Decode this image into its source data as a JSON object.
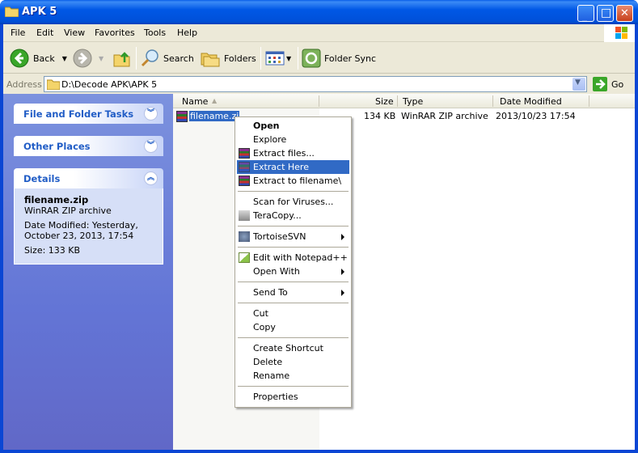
{
  "window": {
    "title": "APK 5",
    "buttons": {
      "minimize": "_",
      "maximize": "□",
      "close": "✕"
    }
  },
  "menubar": {
    "items": [
      "File",
      "Edit",
      "View",
      "Favorites",
      "Tools",
      "Help"
    ]
  },
  "toolbar": {
    "back_label": "Back",
    "search_label": "Search",
    "folders_label": "Folders",
    "folder_sync_label": "Folder Sync"
  },
  "address": {
    "label": "Address",
    "value": "D:\\Decode APK\\APK 5",
    "go_label": "Go"
  },
  "leftpane": {
    "panels": [
      {
        "title": "File and Folder Tasks",
        "chevron": "expand"
      },
      {
        "title": "Other Places",
        "chevron": "expand"
      },
      {
        "title": "Details",
        "chevron": "collapse"
      }
    ],
    "details": {
      "filename": "filename.zip",
      "type": "WinRAR ZIP archive",
      "date_modified_line1": "Date Modified: Yesterday,",
      "date_modified_line2": "October 23, 2013, 17:54",
      "size": "Size: 133 KB"
    }
  },
  "filelist": {
    "columns": [
      "Name",
      "Size",
      "Type",
      "Date Modified"
    ],
    "rows": [
      {
        "name": "filename.zip",
        "size": "134 KB",
        "type": "WinRAR ZIP archive",
        "date": "2013/10/23 17:54"
      }
    ]
  },
  "context_menu": {
    "groups": [
      [
        {
          "label": "Open",
          "bold": true
        },
        {
          "label": "Explore"
        },
        {
          "label": "Extract files...",
          "icon": "winrar-icon"
        },
        {
          "label": "Extract Here",
          "icon": "winrar-icon",
          "highlighted": true
        },
        {
          "label": "Extract to filename\\",
          "icon": "winrar-icon"
        }
      ],
      [
        {
          "label": "Scan for Viruses..."
        },
        {
          "label": "TeraCopy...",
          "icon": "teracopy-icon"
        }
      ],
      [
        {
          "label": "TortoiseSVN",
          "icon": "tortoisesvn-icon",
          "submenu": true
        }
      ],
      [
        {
          "label": "Edit with Notepad++",
          "icon": "notepadpp-icon"
        },
        {
          "label": "Open With",
          "submenu": true
        }
      ],
      [
        {
          "label": "Send To",
          "submenu": true
        }
      ],
      [
        {
          "label": "Cut"
        },
        {
          "label": "Copy"
        }
      ],
      [
        {
          "label": "Create Shortcut"
        },
        {
          "label": "Delete"
        },
        {
          "label": "Rename"
        }
      ],
      [
        {
          "label": "Properties"
        }
      ]
    ]
  }
}
